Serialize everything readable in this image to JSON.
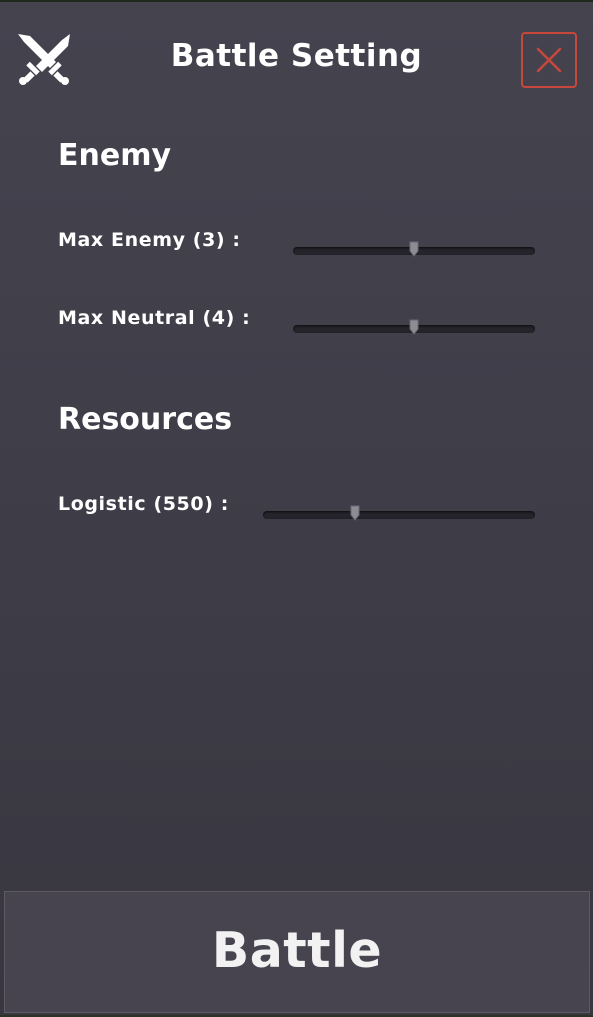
{
  "header": {
    "title": "Battle Setting",
    "logo_icon": "crossed-swords-icon",
    "close_icon": "close-icon",
    "close_color": "#c8473c"
  },
  "sections": [
    {
      "title": "Enemy",
      "settings": [
        {
          "label": "Max Enemy (3) :",
          "value_fraction": 0.5
        },
        {
          "label": "Max Neutral (4) :",
          "value_fraction": 0.5
        }
      ]
    },
    {
      "title": "Resources",
      "settings": [
        {
          "label": "Logistic (550) :",
          "value_fraction": 0.34
        }
      ]
    }
  ],
  "footer": {
    "battle_label": "Battle"
  }
}
